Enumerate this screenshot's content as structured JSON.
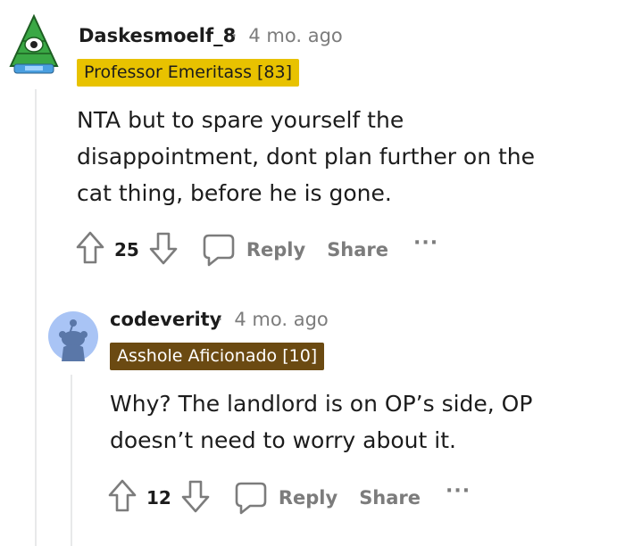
{
  "comments": [
    {
      "username": "Daskesmoelf_8",
      "separator": "·",
      "age": "4 mo. ago",
      "flair": "Professor Emeritass [83]",
      "flair_bg": "#e8c200",
      "flair_fg": "#1c1c1c",
      "avatar_icon": "pyramid-eye-avatar",
      "body_lines": [
        "NTA but to spare yourself the",
        "disappointment, dont plan further on the",
        "cat thing, before he is gone."
      ],
      "votes": "25",
      "reply_label": "Reply",
      "share_label": "Share",
      "more_label": "···"
    },
    {
      "username": "codeverity",
      "separator": "·",
      "age": "4 mo. ago",
      "flair": "Asshole Aficionado [10]",
      "flair_bg": "#6b4a12",
      "flair_fg": "#ffffff",
      "avatar_icon": "snoo-default-avatar",
      "body_lines": [
        "Why? The landlord is on OP’s side, OP",
        "doesn’t need to worry about it."
      ],
      "votes": "12",
      "reply_label": "Reply",
      "share_label": "Share",
      "more_label": "···"
    }
  ]
}
